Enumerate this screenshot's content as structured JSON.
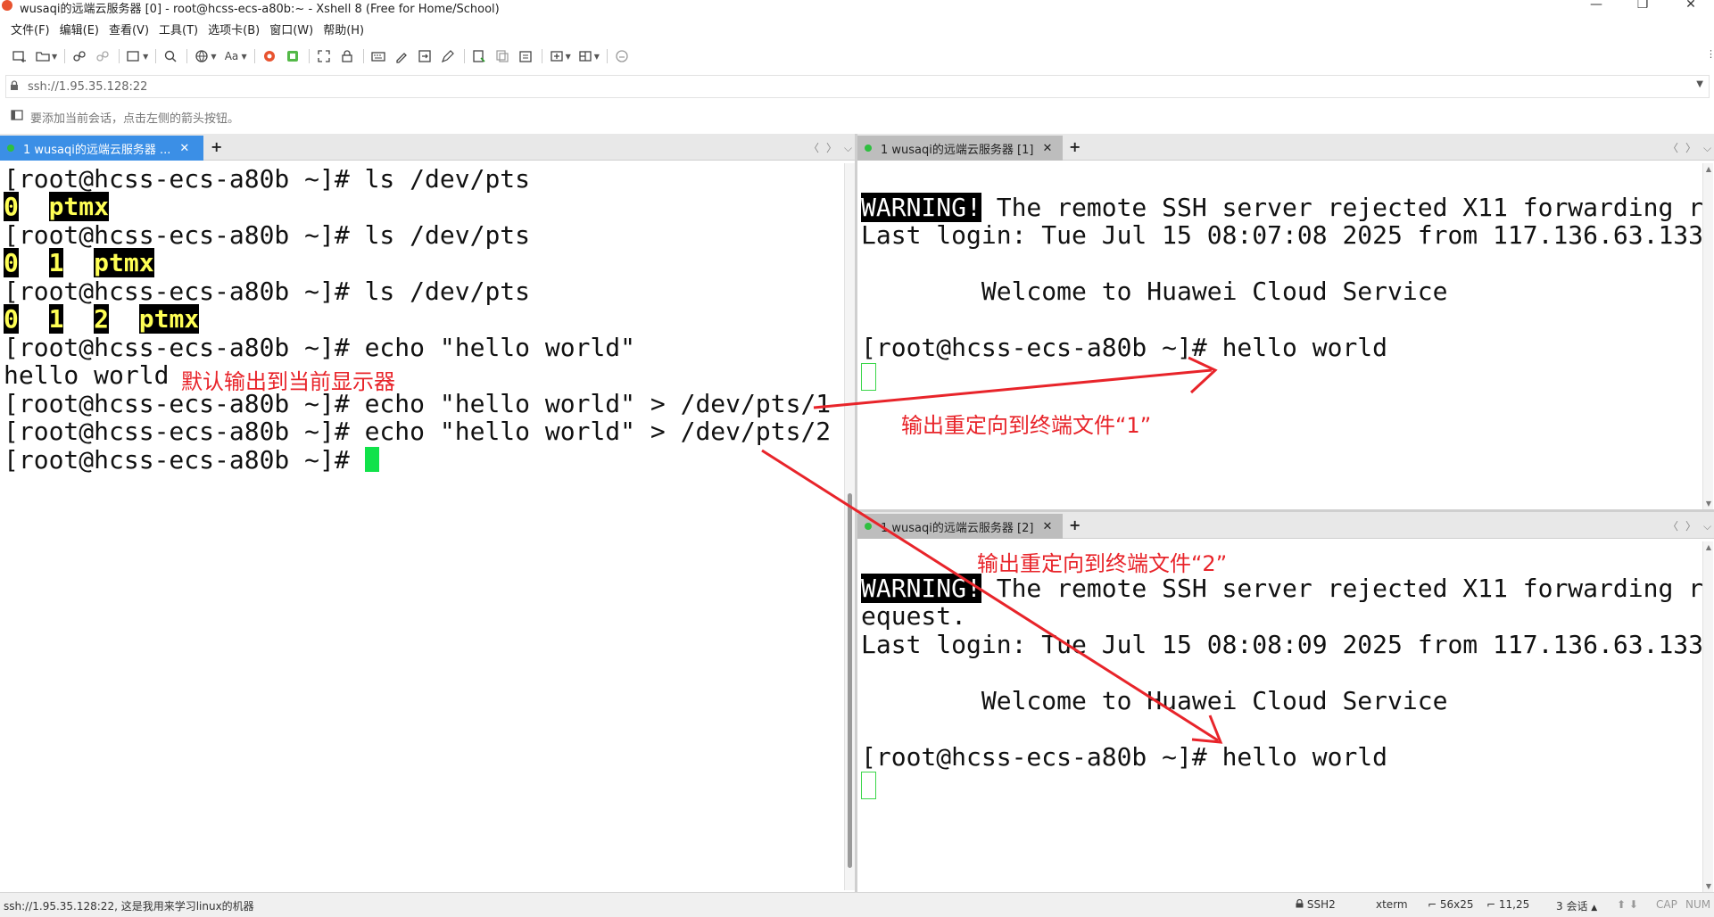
{
  "window": {
    "title": "wusaqi的远端云服务器 [0] - root@hcss-ecs-a80b:~ - Xshell 8 (Free for Home/School)",
    "controls": [
      "—",
      "❐",
      "✕"
    ]
  },
  "menu": [
    "文件(F)",
    "编辑(E)",
    "查看(V)",
    "工具(T)",
    "选项卡(B)",
    "窗口(W)",
    "帮助(H)"
  ],
  "toolbar": {
    "icons": [
      "new-session-icon",
      "open-folder-icon",
      "reconnect-icon",
      "disconnect-icon",
      "new-tab-icon",
      "find-icon",
      "globe-icon",
      "font-icon",
      "xftp-icon",
      "xmanager-icon",
      "fullscreen-icon",
      "lock-icon",
      "keyboard-icon",
      "script-icon",
      "transfer-icon",
      "compose-icon",
      "log-icon",
      "copy-icon",
      "paste-icon",
      "add-icon",
      "layout-icon",
      "help-icon"
    ],
    "font_label": "Aa"
  },
  "address": {
    "value": "ssh://1.95.35.128:22"
  },
  "hint": {
    "text": "要添加当前会话，点击左侧的箭头按钮。"
  },
  "panes": {
    "left": {
      "tab_label": "1 wusaqi的远端云服务器 ...",
      "lines": [
        {
          "prompt": "[root@hcss-ecs-a80b ~]# ",
          "cmd": "ls /dev/pts"
        },
        {
          "segments": [
            "0",
            "ptmx"
          ]
        },
        {
          "prompt": "[root@hcss-ecs-a80b ~]# ",
          "cmd": "ls /dev/pts"
        },
        {
          "segments": [
            "0",
            "1",
            "ptmx"
          ]
        },
        {
          "prompt": "[root@hcss-ecs-a80b ~]# ",
          "cmd": "ls /dev/pts"
        },
        {
          "segments": [
            "0",
            "1",
            "2",
            "ptmx"
          ]
        },
        {
          "prompt": "[root@hcss-ecs-a80b ~]# ",
          "cmd": "echo \"hello world\""
        },
        {
          "output": "hello world"
        },
        {
          "prompt": "[root@hcss-ecs-a80b ~]# ",
          "cmd": "echo \"hello world\" > /dev/pts/1"
        },
        {
          "prompt": "[root@hcss-ecs-a80b ~]# ",
          "cmd": "echo \"hello world\" > /dev/pts/2"
        },
        {
          "prompt": "[root@hcss-ecs-a80b ~]# ",
          "cmd": ""
        }
      ]
    },
    "right_top": {
      "tab_label": "1 wusaqi的远端云服务器 [1]",
      "warning": "WARNING!",
      "warning_rest": " The remote SSH server rejected X11 forwarding r",
      "last_login": "Last login: Tue Jul 15 08:07:08 2025 from 117.136.63.133",
      "welcome": "        Welcome to Huawei Cloud Service",
      "prompt": "[root@hcss-ecs-a80b ~]# ",
      "output": "hello world"
    },
    "right_bottom": {
      "tab_label": "1 wusaqi的远端云服务器 [2]",
      "warning": "WARNING!",
      "warning_rest": " The remote SSH server rejected X11 forwarding r",
      "warning_cont": "equest.",
      "last_login": "Last login: Tue Jul 15 08:08:09 2025 from 117.136.63.133",
      "welcome": "        Welcome to Huawei Cloud Service",
      "prompt": "[root@hcss-ecs-a80b ~]# ",
      "output": "hello world"
    }
  },
  "annotations": {
    "default_output": "默认输出到当前显示器",
    "redirect_1": "输出重定向到终端文件“1”",
    "redirect_2": "输出重定向到终端文件“2”",
    "arrow_color": "#e8242a"
  },
  "status": {
    "left": "ssh://1.95.35.128:22, 这是我用来学习linux的机器",
    "protocol": "SSH2",
    "term": "xterm",
    "size": "56x25",
    "position": "11,25",
    "sessions": "3 会话",
    "cap": "CAP",
    "num": "NUM"
  }
}
